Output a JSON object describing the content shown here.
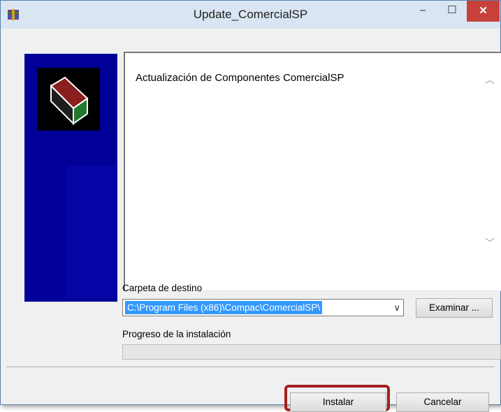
{
  "window": {
    "title": "Update_ComercialSP",
    "app_icon": "winrar-archive-icon",
    "controls": {
      "minimize": "‒",
      "maximize": "☐",
      "close": "✕"
    }
  },
  "sidebar": {
    "logo_icon": "package-box-icon"
  },
  "readme": {
    "text": "Actualización de Componentes ComercialSP",
    "scroll_up": "︿",
    "scroll_down": "﹀"
  },
  "destination": {
    "label": "Carpeta de destino",
    "value": "C:\\Program Files (x86)\\Compac\\ComercialSP\\",
    "dropdown_arrow": "∨",
    "browse_label": "Examinar ..."
  },
  "progress": {
    "label": "Progreso de la instalación",
    "value": 0
  },
  "footer": {
    "install_label": "Instalar",
    "cancel_label": "Cancelar"
  },
  "colors": {
    "sidebar": "#000099",
    "close_button": "#c7413a",
    "selection": "#3399ff",
    "highlight": "#a31f1f"
  }
}
